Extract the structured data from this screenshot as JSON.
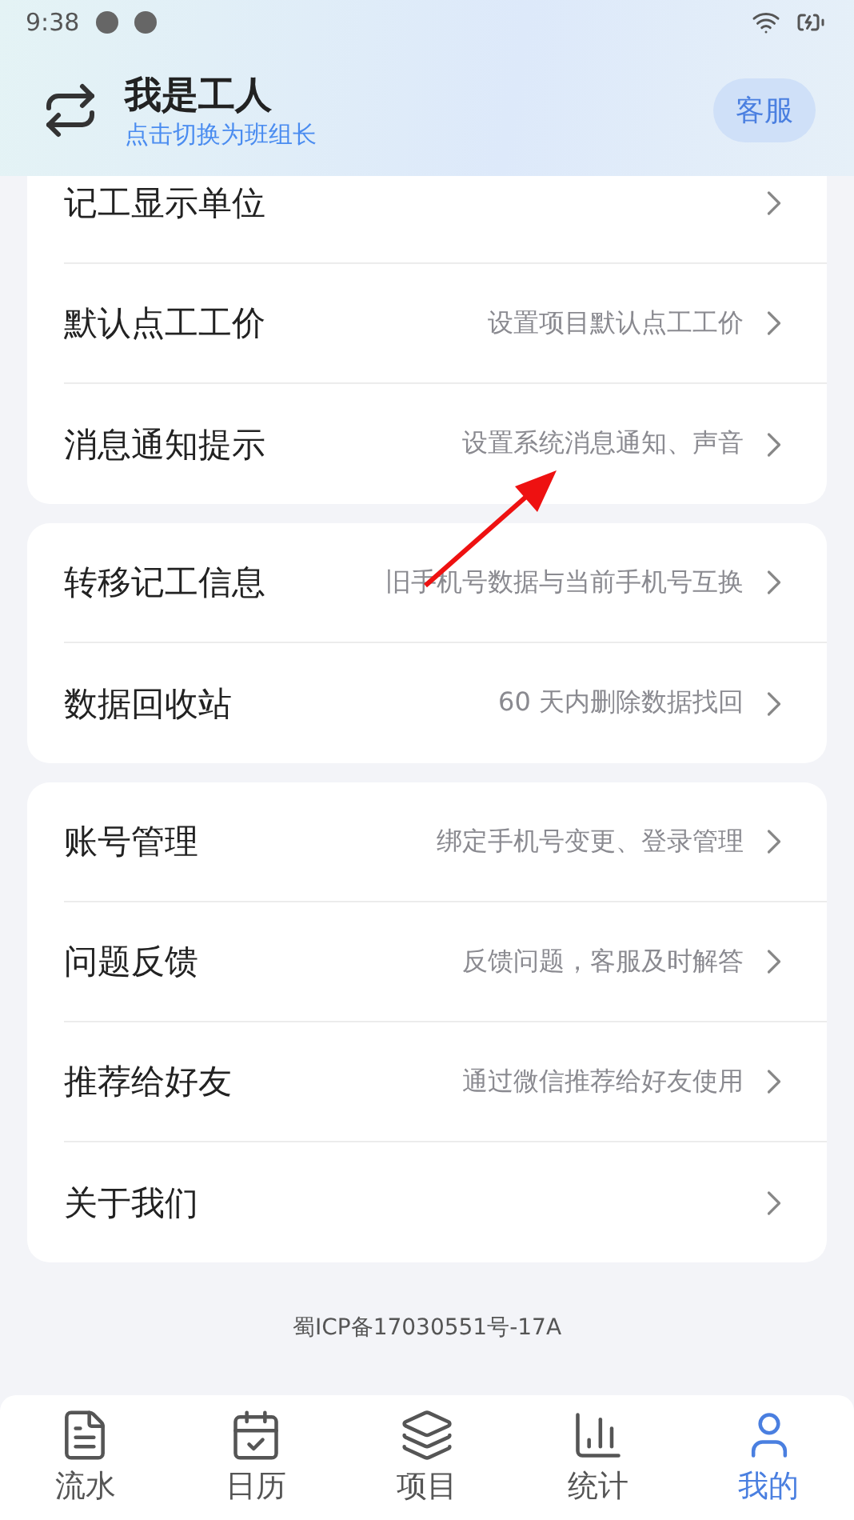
{
  "status_bar": {
    "time": "9:38"
  },
  "header": {
    "title": "我是工人",
    "subtitle": "点击切换为班组长",
    "service_button": "客服"
  },
  "sections": [
    {
      "rows": [
        {
          "label": "记工显示单位",
          "hint": ""
        },
        {
          "label": "默认点工工价",
          "hint": "设置项目默认点工工价"
        },
        {
          "label": "消息通知提示",
          "hint": "设置系统消息通知、声音"
        }
      ]
    },
    {
      "rows": [
        {
          "label": "转移记工信息",
          "hint": "旧手机号数据与当前手机号互换"
        },
        {
          "label": "数据回收站",
          "hint": "60 天内删除数据找回"
        }
      ]
    },
    {
      "rows": [
        {
          "label": "账号管理",
          "hint": "绑定手机号变更、登录管理"
        },
        {
          "label": "问题反馈",
          "hint": "反馈问题，客服及时解答"
        },
        {
          "label": "推荐给好友",
          "hint": "通过微信推荐给好友使用"
        },
        {
          "label": "关于我们",
          "hint": ""
        }
      ]
    }
  ],
  "footer": {
    "icp": "蜀ICP备17030551号-17A"
  },
  "tab_bar": [
    {
      "kind": "flow",
      "label": "流水",
      "selected": false
    },
    {
      "kind": "calendar",
      "label": "日历",
      "selected": false
    },
    {
      "kind": "projects",
      "label": "项目",
      "selected": false
    },
    {
      "kind": "stats",
      "label": "统计",
      "selected": false
    },
    {
      "kind": "mine",
      "label": "我的",
      "selected": true
    }
  ]
}
